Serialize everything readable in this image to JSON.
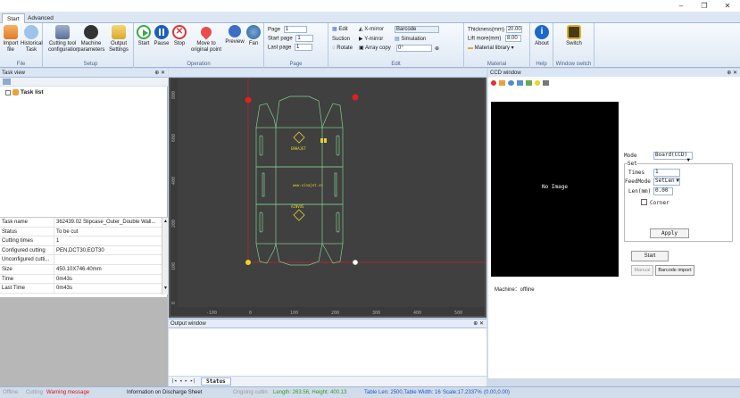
{
  "window": {
    "minimize": "–",
    "maximize": "❐",
    "close": "✕"
  },
  "tabs": [
    {
      "label": "Start",
      "active": true
    },
    {
      "label": "Advanced",
      "active": false
    }
  ],
  "ribbon": {
    "file": {
      "group_label": "File",
      "import_label": "Import\nfile",
      "historical_label": "Historical\nTask"
    },
    "setup": {
      "group_label": "Setup",
      "cutting_tool_label": "Cutting tool\nconfiguration",
      "machine_label": "Machine\nparameters",
      "output_label": "Output\nSettings"
    },
    "operation": {
      "group_label": "Operation",
      "start_label": "Start",
      "pause_label": "Pause",
      "stop_label": "Stop",
      "move_label": "Move to\noriginal point",
      "preview_label": "Preview",
      "fan_label": "Fan"
    },
    "page": {
      "group_label": "Page",
      "page_label": "Page",
      "page_value": "1",
      "start_page_label": "Start page",
      "start_page_value": "1",
      "last_page_label": "Last page",
      "last_page_value": "1"
    },
    "edit": {
      "group_label": "Edit",
      "edit_label": "Edit",
      "xmirror_label": "X-mirror",
      "barcode_label": "Barcode",
      "suction_label": "Suction",
      "ymirror_label": "Y-mirror",
      "simulation_label": "Simulation",
      "rotate_label": "Rotate",
      "array_copy_label": "Array copy",
      "rotate_value": "0°"
    },
    "material": {
      "group_label": "Material",
      "thickness_label": "Thickness(mm)",
      "thickness_value": "20.00",
      "lift_label": "Lift more(mm)",
      "lift_value": "8.00",
      "library_label": "Material library ▾"
    },
    "help": {
      "group_label": "Help",
      "about_label": "About"
    },
    "window_switch": {
      "group_label": "Window switch",
      "switch_label": "Switch"
    }
  },
  "task_view": {
    "title": "Task view",
    "pin": "⊕ ✕",
    "tree_label": "Task list",
    "properties": [
      {
        "key": "Task name",
        "value": "362439.02 Slipcase_Outer_Double Wall..."
      },
      {
        "key": "Status",
        "value": "To be cut"
      },
      {
        "key": "Cutting times",
        "value": "1"
      },
      {
        "key": "Configured cutting",
        "value": "PEN,DCT30,EOT30"
      },
      {
        "key": "Unconfigured cutti...",
        "value": ""
      },
      {
        "key": "Size",
        "value": "450.10X746.40mm"
      },
      {
        "key": "Time",
        "value": "0m43s"
      },
      {
        "key": "Last Time",
        "value": "0m43s"
      }
    ]
  },
  "canvas": {
    "ruler_x": [
      "-100",
      "0",
      "100",
      "200",
      "300",
      "400",
      "500"
    ],
    "ruler_y": [
      "800",
      "600",
      "400",
      "200",
      "100",
      "0"
    ],
    "brand_top": "ENHAJET",
    "url_text": "www.xinajet.cn",
    "brand_bottom": "AINVOS"
  },
  "output_window": {
    "title": "Output window",
    "pin": "⊕ ✕",
    "status_tab": "Status",
    "nav": "|◂ ◂ ▸ ▸|"
  },
  "ccd": {
    "title": "CCD window",
    "pin": "⊕ ✕",
    "no_image": "No Image",
    "mode_label": "Mode",
    "mode_value": "Board(CCD)",
    "set_label": "Set",
    "times_label": "Times",
    "times_value": "1",
    "feedmode_label": "FeedMode",
    "feedmode_value": "SetLen",
    "len_label": "Len(mm)",
    "len_value": "0.00",
    "corner_label": "Corner",
    "apply_label": "Apply",
    "start_label": "Start",
    "manual_label": "Manual",
    "barcode_import_label": "Barcode import",
    "machine_status": "Machine：offline"
  },
  "statusbar": {
    "offline": "Offline",
    "cutting": "Cutting",
    "warning": "Warning message",
    "discharge": "Information on Discharge Sheet",
    "ongoing": "Ongoing cuttin",
    "dimensions": "Length: 263.56, Height: 400.13",
    "table": "Table Len: 2500,Table Width: 16",
    "scale": "Scale:17.2337%",
    "coords": "(0.00,0.00)"
  },
  "colors": {
    "ribbon_bg": "#dfe9f5",
    "canvas_bg": "#404040",
    "die_line": "#7fcf8a",
    "warning": "#d11",
    "status_green": "#2a9a2a",
    "status_blue": "#1c54c4"
  }
}
